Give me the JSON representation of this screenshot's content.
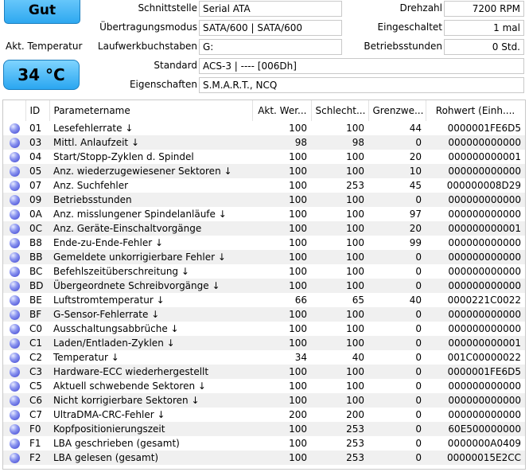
{
  "health": {
    "label": "Gut"
  },
  "temperature": {
    "label": "Akt. Temperatur",
    "value": "34 °C"
  },
  "info": {
    "interface": {
      "label": "Schnittstelle",
      "value": "Serial ATA"
    },
    "transfer_mode": {
      "label": "Übertragungsmodus",
      "value": "SATA/600 | SATA/600"
    },
    "drive_letters": {
      "label": "Laufwerkbuchstaben",
      "value": "G:"
    },
    "standard": {
      "label": "Standard",
      "value": "ACS-3 | ---- [006Dh]"
    },
    "features": {
      "label": "Eigenschaften",
      "value": "S.M.A.R.T., NCQ"
    },
    "rotation": {
      "label": "Drehzahl",
      "value": "7200 RPM"
    },
    "power_on_count": {
      "label": "Eingeschaltet",
      "value": "1 mal"
    },
    "power_on_hours": {
      "label": "Betriebsstunden",
      "value": "0 Std."
    }
  },
  "table": {
    "headers": {
      "id": "ID",
      "name": "Parametername",
      "current": "Akt. Wer...",
      "worst": "Schlecht...",
      "threshold": "Grenzwe...",
      "raw": "Rohwert (Einh...."
    },
    "rows": [
      {
        "id": "01",
        "name": "Lesefehlerrate",
        "current": "100",
        "worst": "100",
        "threshold": "44",
        "raw": "0000001FE6D5"
      },
      {
        "id": "03",
        "name": "Mittl. Anlaufzeit",
        "current": "98",
        "worst": "98",
        "threshold": "0",
        "raw": "000000000000"
      },
      {
        "id": "04",
        "name": "Start/Stopp-Zyklen d. Spindel",
        "current": "100",
        "worst": "100",
        "threshold": "20",
        "raw": "000000000001"
      },
      {
        "id": "05",
        "name": "Anz. wiederzugewiesener Sektoren",
        "current": "100",
        "worst": "100",
        "threshold": "10",
        "raw": "000000000000"
      },
      {
        "id": "07",
        "name": "Anz. Suchfehler",
        "current": "100",
        "worst": "253",
        "threshold": "45",
        "raw": "000000008D29"
      },
      {
        "id": "09",
        "name": "Betriebsstunden",
        "current": "100",
        "worst": "100",
        "threshold": "0",
        "raw": "000000000000"
      },
      {
        "id": "0A",
        "name": "Anz. misslungener Spindelanläufe",
        "current": "100",
        "worst": "100",
        "threshold": "97",
        "raw": "000000000000"
      },
      {
        "id": "0C",
        "name": "Anz. Geräte-Einschaltvorgänge",
        "current": "100",
        "worst": "100",
        "threshold": "20",
        "raw": "000000000001"
      },
      {
        "id": "B8",
        "name": "Ende-zu-Ende-Fehler",
        "current": "100",
        "worst": "100",
        "threshold": "99",
        "raw": "000000000000"
      },
      {
        "id": "BB",
        "name": "Gemeldete unkorrigierbare Fehler",
        "current": "100",
        "worst": "100",
        "threshold": "0",
        "raw": "000000000000"
      },
      {
        "id": "BC",
        "name": "Befehlszeitüberschreitung",
        "current": "100",
        "worst": "100",
        "threshold": "0",
        "raw": "000000000000"
      },
      {
        "id": "BD",
        "name": "Übergeordnete Schreibvorgänge",
        "current": "100",
        "worst": "100",
        "threshold": "0",
        "raw": "000000000000"
      },
      {
        "id": "BE",
        "name": "Luftstromtemperatur",
        "current": "66",
        "worst": "65",
        "threshold": "40",
        "raw": "0000221C0022"
      },
      {
        "id": "BF",
        "name": "G-Sensor-Fehlerrate",
        "current": "100",
        "worst": "100",
        "threshold": "0",
        "raw": "000000000000"
      },
      {
        "id": "C0",
        "name": "Ausschaltungsabbrüche",
        "current": "100",
        "worst": "100",
        "threshold": "0",
        "raw": "000000000000"
      },
      {
        "id": "C1",
        "name": "Laden/Entladen-Zyklen",
        "current": "100",
        "worst": "100",
        "threshold": "0",
        "raw": "000000000001"
      },
      {
        "id": "C2",
        "name": "Temperatur",
        "current": "34",
        "worst": "40",
        "threshold": "0",
        "raw": "001C00000022"
      },
      {
        "id": "C3",
        "name": "Hardware-ECC wiederhergestellt",
        "current": "100",
        "worst": "100",
        "threshold": "0",
        "raw": "0000001FE6D5"
      },
      {
        "id": "C5",
        "name": "Aktuell schwebende Sektoren",
        "current": "100",
        "worst": "100",
        "threshold": "0",
        "raw": "000000000000"
      },
      {
        "id": "C6",
        "name": "Nicht korrigierbare Sektoren",
        "current": "100",
        "worst": "100",
        "threshold": "0",
        "raw": "000000000000"
      },
      {
        "id": "C7",
        "name": "UltraDMA-CRC-Fehler",
        "current": "200",
        "worst": "200",
        "threshold": "0",
        "raw": "000000000000"
      },
      {
        "id": "F0",
        "name": "Kopfpositionierungszeit",
        "current": "100",
        "worst": "253",
        "threshold": "0",
        "raw": "60E500000000"
      },
      {
        "id": "F1",
        "name": "LBA geschrieben (gesamt)",
        "current": "100",
        "worst": "253",
        "threshold": "0",
        "raw": "0000000A0409"
      },
      {
        "id": "F2",
        "name": "LBA gelesen (gesamt)",
        "current": "100",
        "worst": "253",
        "threshold": "0",
        "raw": "00000015E2CC"
      }
    ],
    "arrow_rows": [
      "01",
      "03",
      "05",
      "0A",
      "B8",
      "BB",
      "BC",
      "BD",
      "BE",
      "BF",
      "C0",
      "C1",
      "C2",
      "C5",
      "C6",
      "C7"
    ],
    "status_color": "#4a55e0"
  }
}
